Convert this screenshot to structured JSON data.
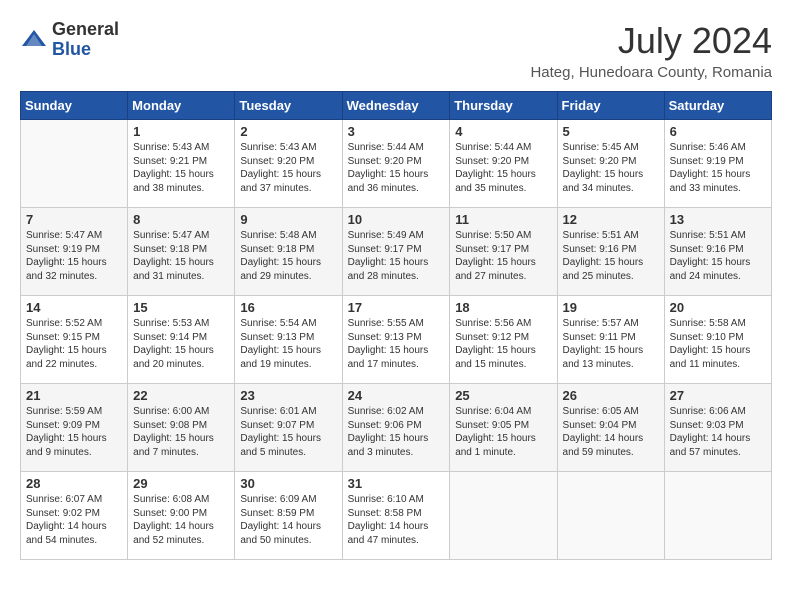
{
  "header": {
    "logo_line1": "General",
    "logo_line2": "Blue",
    "month_year": "July 2024",
    "location": "Hateg, Hunedoara County, Romania"
  },
  "weekdays": [
    "Sunday",
    "Monday",
    "Tuesday",
    "Wednesday",
    "Thursday",
    "Friday",
    "Saturday"
  ],
  "weeks": [
    [
      {
        "day": "",
        "info": ""
      },
      {
        "day": "1",
        "info": "Sunrise: 5:43 AM\nSunset: 9:21 PM\nDaylight: 15 hours\nand 38 minutes."
      },
      {
        "day": "2",
        "info": "Sunrise: 5:43 AM\nSunset: 9:20 PM\nDaylight: 15 hours\nand 37 minutes."
      },
      {
        "day": "3",
        "info": "Sunrise: 5:44 AM\nSunset: 9:20 PM\nDaylight: 15 hours\nand 36 minutes."
      },
      {
        "day": "4",
        "info": "Sunrise: 5:44 AM\nSunset: 9:20 PM\nDaylight: 15 hours\nand 35 minutes."
      },
      {
        "day": "5",
        "info": "Sunrise: 5:45 AM\nSunset: 9:20 PM\nDaylight: 15 hours\nand 34 minutes."
      },
      {
        "day": "6",
        "info": "Sunrise: 5:46 AM\nSunset: 9:19 PM\nDaylight: 15 hours\nand 33 minutes."
      }
    ],
    [
      {
        "day": "7",
        "info": "Sunrise: 5:47 AM\nSunset: 9:19 PM\nDaylight: 15 hours\nand 32 minutes."
      },
      {
        "day": "8",
        "info": "Sunrise: 5:47 AM\nSunset: 9:18 PM\nDaylight: 15 hours\nand 31 minutes."
      },
      {
        "day": "9",
        "info": "Sunrise: 5:48 AM\nSunset: 9:18 PM\nDaylight: 15 hours\nand 29 minutes."
      },
      {
        "day": "10",
        "info": "Sunrise: 5:49 AM\nSunset: 9:17 PM\nDaylight: 15 hours\nand 28 minutes."
      },
      {
        "day": "11",
        "info": "Sunrise: 5:50 AM\nSunset: 9:17 PM\nDaylight: 15 hours\nand 27 minutes."
      },
      {
        "day": "12",
        "info": "Sunrise: 5:51 AM\nSunset: 9:16 PM\nDaylight: 15 hours\nand 25 minutes."
      },
      {
        "day": "13",
        "info": "Sunrise: 5:51 AM\nSunset: 9:16 PM\nDaylight: 15 hours\nand 24 minutes."
      }
    ],
    [
      {
        "day": "14",
        "info": "Sunrise: 5:52 AM\nSunset: 9:15 PM\nDaylight: 15 hours\nand 22 minutes."
      },
      {
        "day": "15",
        "info": "Sunrise: 5:53 AM\nSunset: 9:14 PM\nDaylight: 15 hours\nand 20 minutes."
      },
      {
        "day": "16",
        "info": "Sunrise: 5:54 AM\nSunset: 9:13 PM\nDaylight: 15 hours\nand 19 minutes."
      },
      {
        "day": "17",
        "info": "Sunrise: 5:55 AM\nSunset: 9:13 PM\nDaylight: 15 hours\nand 17 minutes."
      },
      {
        "day": "18",
        "info": "Sunrise: 5:56 AM\nSunset: 9:12 PM\nDaylight: 15 hours\nand 15 minutes."
      },
      {
        "day": "19",
        "info": "Sunrise: 5:57 AM\nSunset: 9:11 PM\nDaylight: 15 hours\nand 13 minutes."
      },
      {
        "day": "20",
        "info": "Sunrise: 5:58 AM\nSunset: 9:10 PM\nDaylight: 15 hours\nand 11 minutes."
      }
    ],
    [
      {
        "day": "21",
        "info": "Sunrise: 5:59 AM\nSunset: 9:09 PM\nDaylight: 15 hours\nand 9 minutes."
      },
      {
        "day": "22",
        "info": "Sunrise: 6:00 AM\nSunset: 9:08 PM\nDaylight: 15 hours\nand 7 minutes."
      },
      {
        "day": "23",
        "info": "Sunrise: 6:01 AM\nSunset: 9:07 PM\nDaylight: 15 hours\nand 5 minutes."
      },
      {
        "day": "24",
        "info": "Sunrise: 6:02 AM\nSunset: 9:06 PM\nDaylight: 15 hours\nand 3 minutes."
      },
      {
        "day": "25",
        "info": "Sunrise: 6:04 AM\nSunset: 9:05 PM\nDaylight: 15 hours\nand 1 minute."
      },
      {
        "day": "26",
        "info": "Sunrise: 6:05 AM\nSunset: 9:04 PM\nDaylight: 14 hours\nand 59 minutes."
      },
      {
        "day": "27",
        "info": "Sunrise: 6:06 AM\nSunset: 9:03 PM\nDaylight: 14 hours\nand 57 minutes."
      }
    ],
    [
      {
        "day": "28",
        "info": "Sunrise: 6:07 AM\nSunset: 9:02 PM\nDaylight: 14 hours\nand 54 minutes."
      },
      {
        "day": "29",
        "info": "Sunrise: 6:08 AM\nSunset: 9:00 PM\nDaylight: 14 hours\nand 52 minutes."
      },
      {
        "day": "30",
        "info": "Sunrise: 6:09 AM\nSunset: 8:59 PM\nDaylight: 14 hours\nand 50 minutes."
      },
      {
        "day": "31",
        "info": "Sunrise: 6:10 AM\nSunset: 8:58 PM\nDaylight: 14 hours\nand 47 minutes."
      },
      {
        "day": "",
        "info": ""
      },
      {
        "day": "",
        "info": ""
      },
      {
        "day": "",
        "info": ""
      }
    ]
  ]
}
